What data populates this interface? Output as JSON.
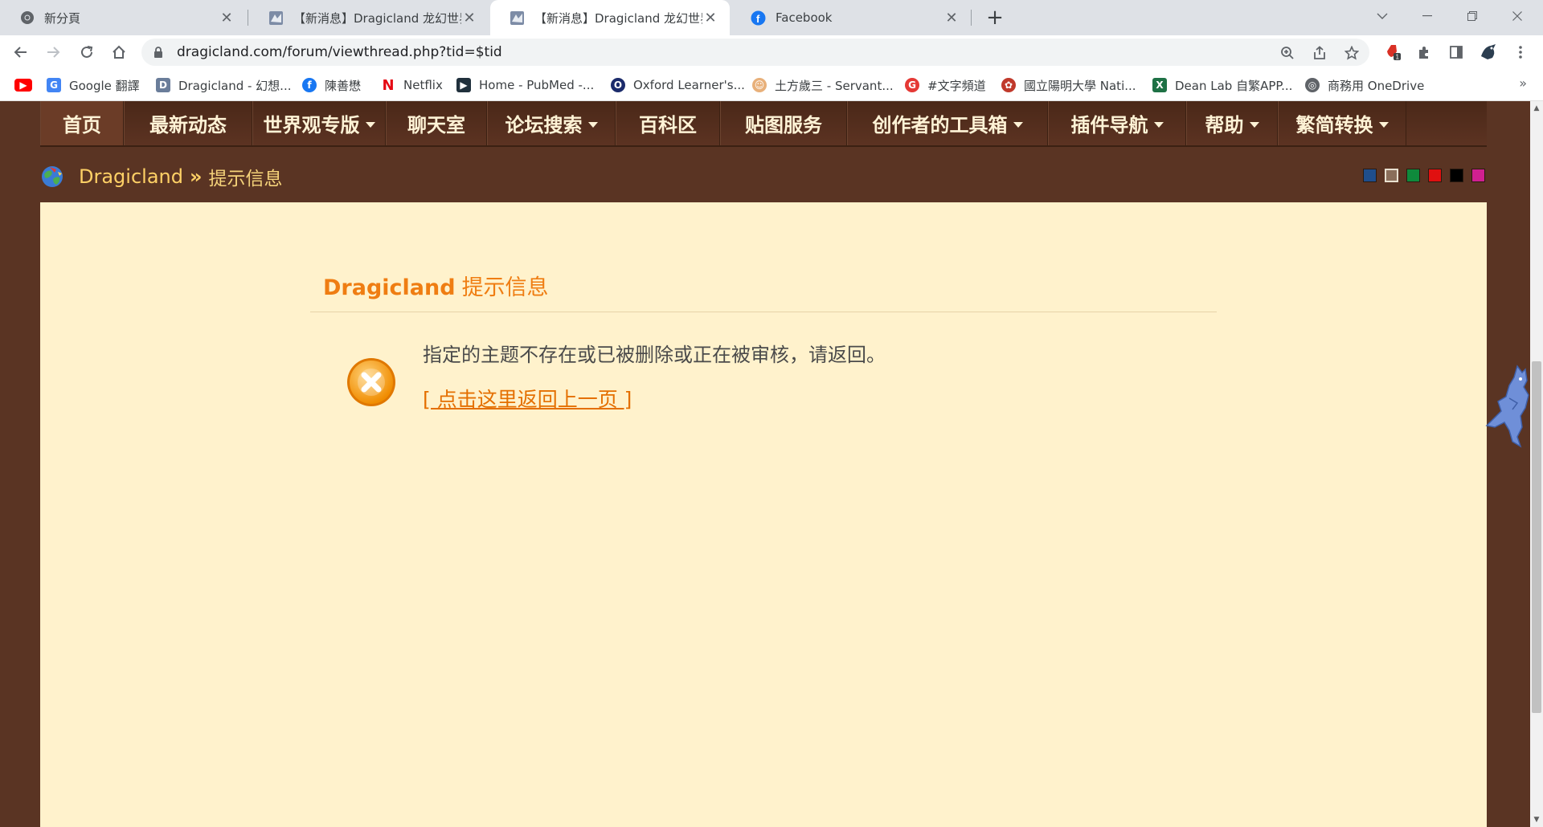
{
  "browser": {
    "tabs": [
      {
        "title": "新分頁",
        "icon": "chrome-icon",
        "active": false
      },
      {
        "title": "【新消息】Dragicland 龙幻世界",
        "icon": "dragicland-icon",
        "active": false
      },
      {
        "title": "【新消息】Dragicland 龙幻世界",
        "icon": "dragicland-icon",
        "active": true
      },
      {
        "title": "Facebook",
        "icon": "facebook-icon",
        "active": false
      }
    ],
    "close_glyph": "✕",
    "new_tab_glyph": "+",
    "url": "dragicland.com/forum/viewthread.php?tid=$tid",
    "bookmarks": [
      {
        "label": "",
        "icon": "youtube-icon",
        "color": "#ff0000"
      },
      {
        "label": "Google 翻譯",
        "icon": "google-translate-icon",
        "color": "#4285f4"
      },
      {
        "label": "Dragicland - 幻想...",
        "icon": "dragicland-icon",
        "color": "#6a7d9a"
      },
      {
        "label": "陳善懋",
        "icon": "facebook-icon",
        "color": "#1877f2"
      },
      {
        "label": "Netflix",
        "icon": "netflix-icon",
        "color": "#e50914"
      },
      {
        "label": "Home - PubMed -...",
        "icon": "pubmed-icon",
        "color": "#20303c"
      },
      {
        "label": "Oxford Learner's...",
        "icon": "oxford-icon",
        "color": "#1b2b6b"
      },
      {
        "label": "土方歲三 - Servant...",
        "icon": "servant-icon",
        "color": "#e8b07a"
      },
      {
        "label": "#文字頻道",
        "icon": "discord-icon",
        "color": "#e53935"
      },
      {
        "label": "國立陽明大學 Nati...",
        "icon": "university-icon",
        "color": "#c0392b"
      },
      {
        "label": "Dean Lab 自繁APP...",
        "icon": "excel-icon",
        "color": "#1e7145"
      },
      {
        "label": "商務用 OneDrive",
        "icon": "globe-icon",
        "color": "#5f6368"
      }
    ],
    "bookmarks_more": "»"
  },
  "nav": {
    "items": [
      {
        "label": "首页",
        "dropdown": false
      },
      {
        "label": "最新动态",
        "dropdown": false
      },
      {
        "label": "世界观专版",
        "dropdown": true
      },
      {
        "label": "聊天室",
        "dropdown": false
      },
      {
        "label": "论坛搜索",
        "dropdown": true
      },
      {
        "label": "百科区",
        "dropdown": false
      },
      {
        "label": "贴图服务",
        "dropdown": false
      },
      {
        "label": "创作者的工具箱",
        "dropdown": true
      },
      {
        "label": "插件导航",
        "dropdown": true
      },
      {
        "label": "帮助",
        "dropdown": true
      },
      {
        "label": "繁简转换",
        "dropdown": true
      }
    ]
  },
  "breadcrumb": {
    "site": "Dragicland",
    "separator": "»",
    "current": "提示信息"
  },
  "theme_swatches": [
    "#1f4e8c",
    "#8a6e5a",
    "#0f8a3c",
    "#e01010",
    "#000000",
    "#d02090"
  ],
  "notice": {
    "title_brand": "Dragicland",
    "title_text": "提示信息",
    "message": "指定的主题不存在或已被删除或正在被审核，请返回。",
    "back_link": "[ 点击这里返回上一页 ]",
    "colors": {
      "accent": "#ef7d12",
      "icon": "#f5a11e"
    }
  }
}
